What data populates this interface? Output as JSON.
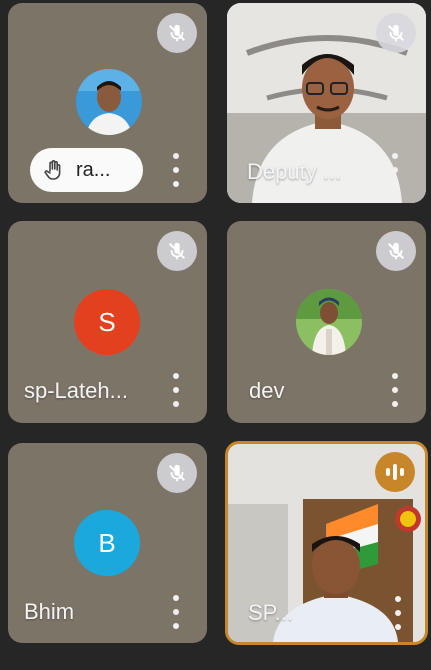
{
  "participants": [
    {
      "name": "ra...",
      "mic_muted": true,
      "hand_raised": true
    },
    {
      "name": "Deputy ...",
      "mic_muted": true,
      "video_on": true
    },
    {
      "name": "sp-Lateh...",
      "mic_muted": true,
      "initial": "S",
      "avatar_color": "#e3401f"
    },
    {
      "name": "dev",
      "mic_muted": true
    },
    {
      "name": "Bhim",
      "mic_muted": true,
      "initial": "B",
      "avatar_color": "#1aa8dd"
    },
    {
      "name": "SP...",
      "speaking": true,
      "video_on": true
    }
  ],
  "icons": {
    "mic_off": "mic-off-icon",
    "more": "more-vert-icon",
    "hand": "raised-hand-icon",
    "speaking": "audio-level-icon"
  },
  "colors": {
    "tile": "#7d7468",
    "active_border": "#c8862a",
    "background": "#262626"
  }
}
